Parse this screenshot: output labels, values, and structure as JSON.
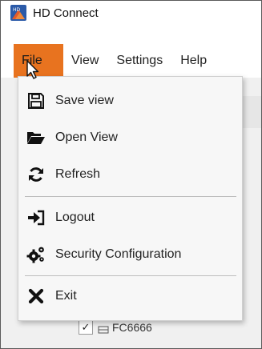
{
  "window": {
    "title": "HD Connect",
    "app_icon": "hd-connect-app-icon"
  },
  "menubar": {
    "items": [
      {
        "label": "File",
        "active": true
      },
      {
        "label": "View"
      },
      {
        "label": "Settings"
      },
      {
        "label": "Help"
      }
    ],
    "active_color": "#e8731f"
  },
  "file_menu": {
    "items": [
      {
        "label": "Save view",
        "icon": "save-icon"
      },
      {
        "label": "Open View",
        "icon": "folder-open-icon"
      },
      {
        "label": "Refresh",
        "icon": "refresh-icon"
      },
      {
        "label": "Logout",
        "icon": "logout-icon"
      },
      {
        "label": "Security Configuration",
        "icon": "cogs-icon"
      },
      {
        "label": "Exit",
        "icon": "close-icon"
      }
    ]
  },
  "device_tree": {
    "item": {
      "label": "FC6666",
      "checked": true,
      "check_mark": "✓",
      "icon": "device-icon"
    }
  }
}
